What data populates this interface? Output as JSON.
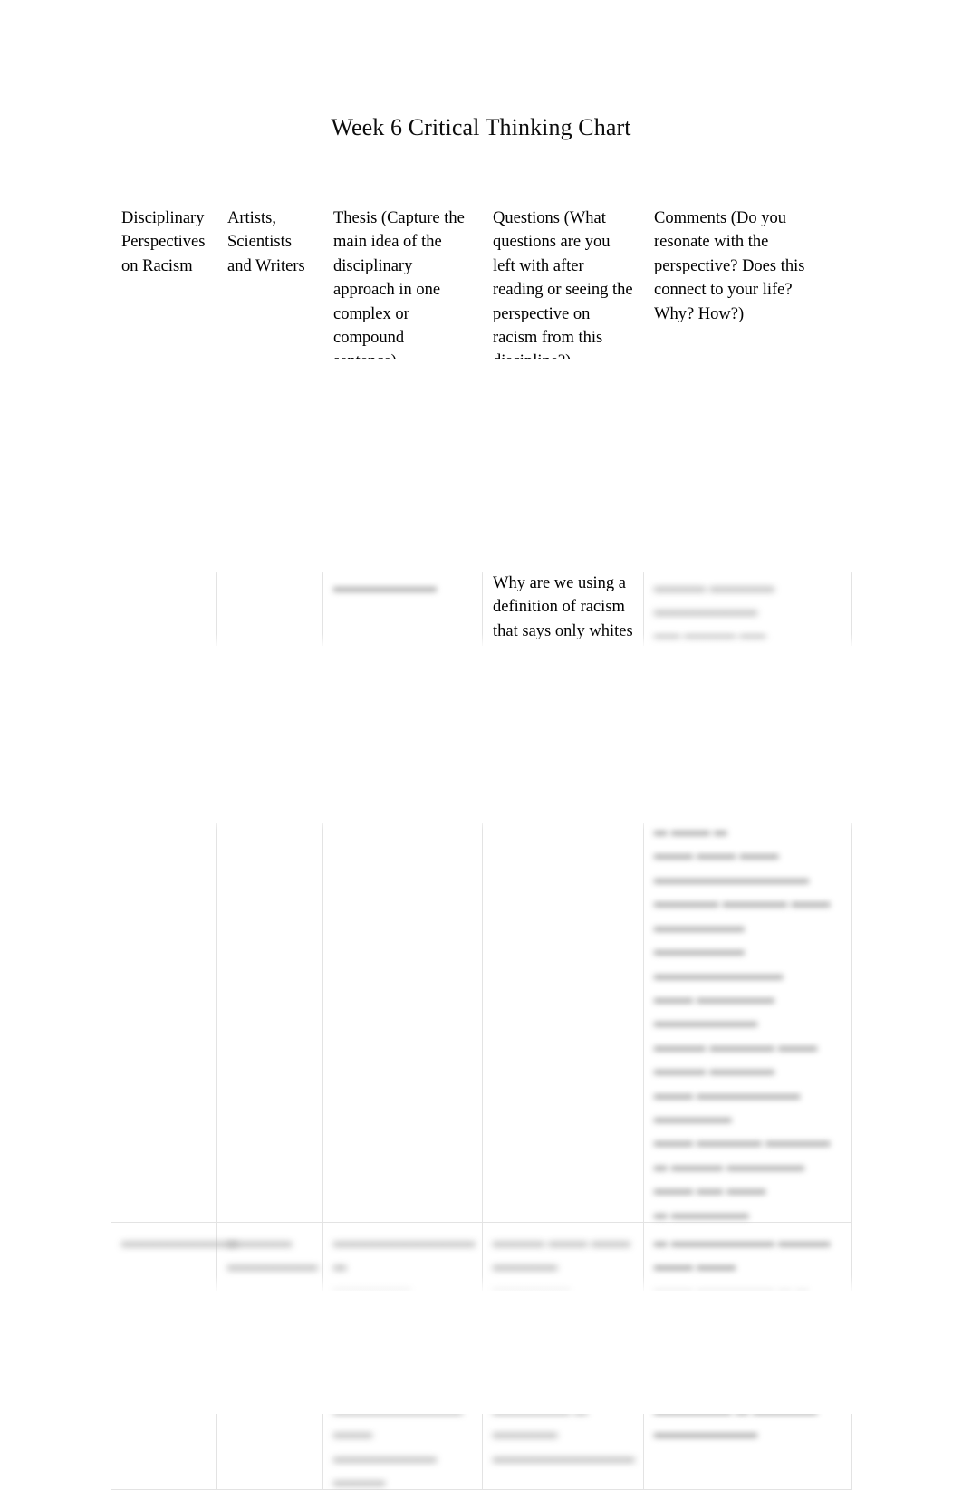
{
  "document": {
    "title": "Week 6 Critical Thinking Chart",
    "page_background": "#ffffff",
    "text_color": "#0d0d0d",
    "gridline_color": "#e3e3e3",
    "redaction_color": "#a8a8a8"
  },
  "table": {
    "columns": [
      "Disciplinary Perspectives on Racism",
      "Artists, Scientists and Writers",
      "Thesis (Capture the main idea of the disciplinary approach in one complex or compound sentence)",
      "Questions (What questions are you left with after reading or seeing the perspective on racism from this discipline?)",
      "Comments (Do you resonate with the perspective?  Does this connect to your life? Why? How?)"
    ],
    "headers_wrapped": [
      "Disciplinary\nPerspectives\non Racism",
      "Artists,\nScientists\nand Writers",
      "Thesis (Capture the\nmain idea of the\ndisciplinary\napproach in one\ncomplex or\ncompound\nsentence)",
      "Questions (What\nquestions are you\nleft with after\nreading or seeing the\nperspective on\nracism from this\ndiscipline?)",
      "Comments (Do you\nresonate with the\nperspective?  Does this\nconnect to your life?\nWhy? How?)"
    ],
    "rows": [
      {
        "row_name": "question-row",
        "cells": [
          {
            "legible": false,
            "text": ""
          },
          {
            "legible": false,
            "text": ""
          },
          {
            "legible": false,
            "text": "▂▂▂▂▂▂▂▂"
          },
          {
            "legible": true,
            "text": "Why are we using a\ndefinition of racism\nthat says only whites"
          },
          {
            "legible": false,
            "text": "▂▂▂▂  ▂▂▂▂▂  ▂▂▂▂▂▂▂▂\n▂▂  ▂▂▂▂  ▂▂\n▂▂▂▂▂▂▂  ▂▂  ▂▂▂▂"
          }
        ]
      },
      {
        "row_name": "body-row",
        "cells": [
          {
            "legible": false,
            "text": ""
          },
          {
            "legible": false,
            "text": ""
          },
          {
            "legible": false,
            "text": ""
          },
          {
            "legible": false,
            "text": ""
          },
          {
            "legible": false,
            "text": "▂▂▂▂▂ ▂▂ ▂▂▂▂▂▂ ▂▂▂ ▂▂▂▂▂\n▂ ▂▂▂▂▂▂▂ ▂▂▂▂  ▂ ▂▂▂▂▂▂▂▂\n▂▂▂ ▂▂▂▂▂▂▂▂▂▂▂▂▂▂  ▂ ▂▂▂ ▂\n▂▂▂  ▂▂▂ ▂▂▂ ▂▂▂▂▂▂▂▂▂▂▂▂\n▂▂▂▂▂ ▂▂▂▂▂ ▂▂▂  ▂▂▂▂▂▂▂\n▂▂▂▂▂▂▂  ▂▂▂▂▂▂▂▂▂▂\n▂▂▂ ▂▂▂▂▂▂ ▂▂▂▂▂▂▂▂\n▂▂▂▂ ▂▂▂▂▂ ▂▂▂ ▂▂▂▂ ▂▂▂▂▂\n▂▂▂ ▂▂▂▂▂▂▂▂ ▂▂▂▂▂▂\n▂▂▂ ▂▂▂▂▂ ▂▂▂▂▂\n▂ ▂▂▂▂ ▂▂▂▂▂▂ ▂▂▂ ▂▂ ▂▂▂\n▂ ▂▂▂▂▂▂"
          }
        ]
      },
      {
        "row_name": "final-row",
        "cells": [
          {
            "legible": false,
            "text": "▂▂▂▂▂▂▂▂▂"
          },
          {
            "legible": false,
            "text": "▂▂▂▂▂\n▂▂▂▂▂▂▂"
          },
          {
            "legible": false,
            "text": "▂▂▂▂▂▂▂▂▂▂▂ ▂\n▂▂▂▂▂▂ ▂▂▂▂▂▂▂ ▂▂▂▂\n▂ ▂▂▂▂▂▂ ▂ ▂▂▂▂▂▂\n▂▂▂▂▂▂▂▂▂▂ ▂▂▂\n▂▂▂▂▂▂▂▂ ▂▂▂▂"
          },
          {
            "legible": false,
            "text": "▂▂▂▂ ▂▂▂ ▂▂▂ ▂▂▂▂▂\n▂▂▂▂▂▂ ▂▂▂▂▂▂▂\n▂▂▂▂▂▂▂▂ ▂▂ ▂▂▂▂ ▂▂▂\n▂ ▂▂▂▂▂ ▂ ▂▂▂▂▂▂ ▂\n▂▂▂▂▂ ▂▂▂▂▂▂▂▂▂▂▂"
          },
          {
            "legible": false,
            "text": "▂ ▂▂▂▂▂▂▂▂ ▂▂▂▂ ▂▂▂ ▂▂▂\n▂▂▂ ▂▂▂▂▂▂ ▂ ▂ ▂▂▂▂▂▂\n▂▂▂▂ ▂▂▂ ▂▂▂▂▂\n▂▂▂▂▂▂▂▂▂▂ ▂▂▂▂▂ ▂▂▂\n▂▂▂▂▂▂ ▂ ▂▂▂▂▂ ▂▂▂▂▂▂▂▂"
          }
        ]
      }
    ]
  }
}
